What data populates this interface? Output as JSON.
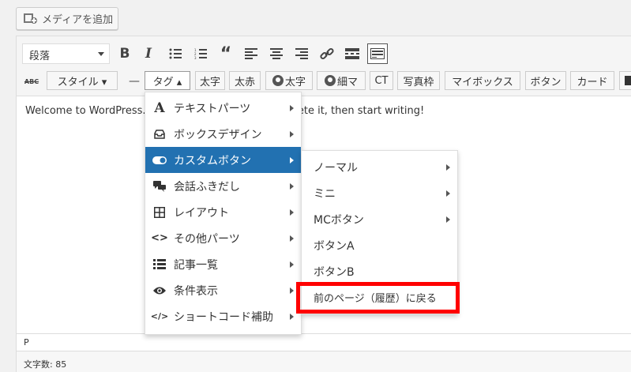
{
  "media_button": {
    "label": "メディアを追加",
    "icon": "media-add-icon"
  },
  "toolbar": {
    "format_select": "段落",
    "row1_icons": [
      "bold-icon",
      "italic-icon",
      "bullet-list-icon",
      "numbered-list-icon",
      "blockquote-icon",
      "align-left-icon",
      "align-center-icon",
      "align-right-icon",
      "link-icon",
      "read-more-icon",
      "toolbar-toggle-icon"
    ],
    "row2": {
      "strikethrough": "ABC",
      "style_label": "スタイル ▾",
      "dash": "—",
      "tag_label": "タグ ▴",
      "buttons": [
        "太字",
        "太赤",
        "太字",
        "細マ",
        "CT",
        "写真枠",
        "マイボックス",
        "ボタン",
        "カード"
      ]
    }
  },
  "content": {
    "text": "Welcome to WordPress. This is your first post. Edit or delete it, then start writing!",
    "visible_left": "Welcome to WordPress.",
    "visible_right": "delete it, then start writing!"
  },
  "statusbar": {
    "path": "P",
    "wordcount": "文字数: 85"
  },
  "menu_tag": {
    "items": [
      {
        "label": "テキストパーツ",
        "icon": "text-A-icon",
        "glyph": "A"
      },
      {
        "label": "ボックスデザイン",
        "icon": "inbox-icon",
        "glyph": ""
      },
      {
        "label": "カスタムボタン",
        "icon": "toggle-icon",
        "glyph": ""
      },
      {
        "label": "会話ふきだし",
        "icon": "chat-bubbles-icon",
        "glyph": ""
      },
      {
        "label": "レイアウト",
        "icon": "grid-icon",
        "glyph": "⊞"
      },
      {
        "label": "その他パーツ",
        "icon": "code-brackets-icon",
        "glyph": "<>"
      },
      {
        "label": "記事一覧",
        "icon": "list-icon",
        "glyph": "☰"
      },
      {
        "label": "条件表示",
        "icon": "eye-icon",
        "glyph": ""
      },
      {
        "label": "ショートコード補助",
        "icon": "shortcode-icon",
        "glyph": "</>"
      }
    ]
  },
  "menu_custom_button": {
    "items": [
      {
        "label": "ノーマル",
        "has_sub": true
      },
      {
        "label": "ミニ",
        "has_sub": true
      },
      {
        "label": "MCボタン",
        "has_sub": true
      },
      {
        "label": "ボタンA",
        "has_sub": false
      },
      {
        "label": "ボタンB",
        "has_sub": false
      },
      {
        "label": "前のページ（履歴）に戻る",
        "has_sub": false
      }
    ]
  },
  "colors": {
    "highlight": "#2271b1",
    "annotation_red": "#ff0000"
  }
}
